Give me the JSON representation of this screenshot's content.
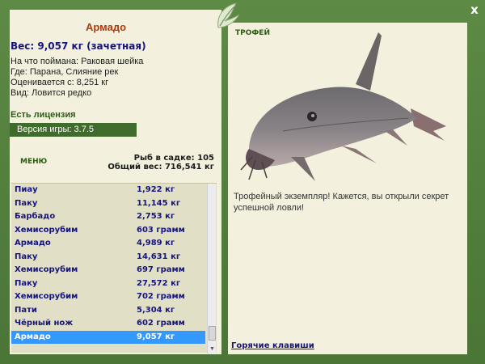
{
  "info": {
    "fish_name": "Армадо",
    "weight_line": "Вес: 9,057 кг (зачетная)",
    "bait": "На что поймана: Раковая шейка",
    "location": "Где: Парана, Слияние рек",
    "valued": "Оценивается с: 8,251 кг",
    "kind": "Вид: Ловится редко",
    "license": "Есть лицензия",
    "version": "Версия игры: 3.7.5"
  },
  "menu_label": "МЕНЮ",
  "keepnet": {
    "count": "Рыб в садке: 105",
    "total": "Общий вес: 716,541 кг"
  },
  "catch_list": [
    {
      "name": "Пиау",
      "weight": "1,922 кг"
    },
    {
      "name": "Паку",
      "weight": "11,145 кг"
    },
    {
      "name": "Барбадо",
      "weight": "2,753 кг"
    },
    {
      "name": "Хемисорубим",
      "weight": "603 грамм"
    },
    {
      "name": "Армадо",
      "weight": "4,989 кг"
    },
    {
      "name": "Паку",
      "weight": "14,631 кг"
    },
    {
      "name": "Хемисорубим",
      "weight": "697 грамм"
    },
    {
      "name": "Паку",
      "weight": "27,572 кг"
    },
    {
      "name": "Хемисорубим",
      "weight": "702 грамм"
    },
    {
      "name": "Пати",
      "weight": "5,304 кг"
    },
    {
      "name": "Чёрный нож",
      "weight": "602 грамм"
    },
    {
      "name": "Армадо",
      "weight": "9,057 кг",
      "selected": true
    }
  ],
  "trophy": {
    "title": "ТРОФЕЙ",
    "text": "Трофейный экземпляр! Кажется, вы открыли секрет успешной ловли!"
  },
  "hotkeys_label": "Горячие клавиши",
  "close_label": "x",
  "icons": {
    "close": "close-icon",
    "logo": "leaf-logo-icon",
    "fish": "armado-fish-image"
  },
  "colors": {
    "frame": "#4e7a3a",
    "panel": "#f3f1de",
    "fish_name": "#b13a0c",
    "weight": "#16157e",
    "selection": "#3399ff"
  }
}
